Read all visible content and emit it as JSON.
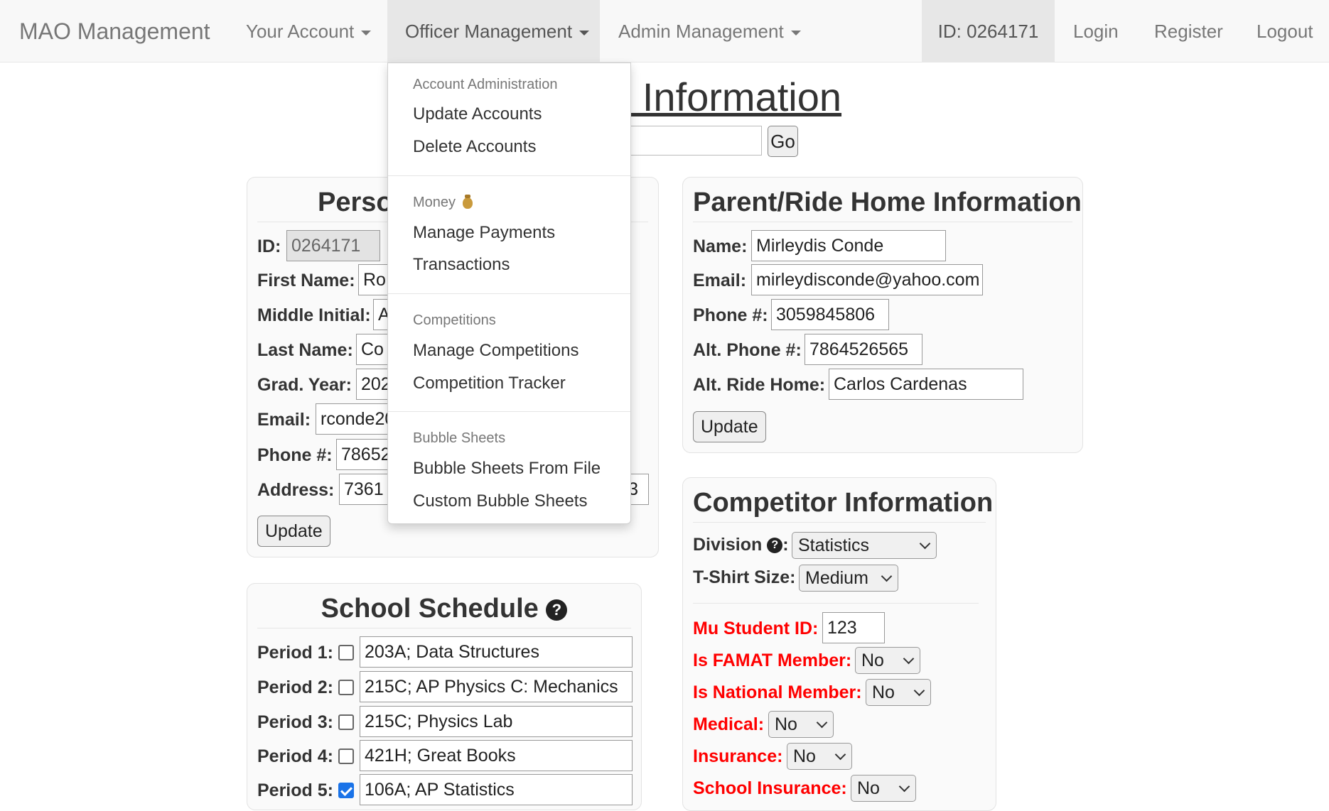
{
  "navbar": {
    "brand": "MAO Management",
    "menus": [
      "Your Account",
      "Officer Management",
      "Admin Management"
    ],
    "id_label": "ID: 0264171",
    "login": "Login",
    "register": "Register",
    "logout": "Logout"
  },
  "page": {
    "title": "Account Information",
    "go": "Go"
  },
  "dropdown": {
    "sections": [
      {
        "header": "Account Administration",
        "items": [
          "Update Accounts",
          "Delete Accounts"
        ]
      },
      {
        "header": "Money",
        "items": [
          "Manage Payments",
          "Transactions"
        ]
      },
      {
        "header": "Competitions",
        "items": [
          "Manage Competitions",
          "Competition Tracker"
        ]
      },
      {
        "header": "Bubble Sheets",
        "items": [
          "Bubble Sheets From File",
          "Custom Bubble Sheets"
        ]
      }
    ]
  },
  "personal": {
    "title": "Personal Information",
    "fields": [
      {
        "label": "ID:",
        "value": "0264171"
      },
      {
        "label": "First Name:",
        "value": "Ro"
      },
      {
        "label": "Middle Initial:",
        "value": "A"
      },
      {
        "label": "Last Name:",
        "value": "Co"
      },
      {
        "label": "Grad. Year:",
        "value": "202"
      },
      {
        "label": "Email:",
        "value": "rconde20"
      },
      {
        "label": "Phone #:",
        "value": "78652"
      },
      {
        "label": "Address:",
        "value": "7361",
        "value_tail": "3"
      }
    ],
    "update": "Update"
  },
  "parent": {
    "title": "Parent/Ride Home Information",
    "fields": [
      {
        "label": "Name:",
        "value": "Mirleydis Conde"
      },
      {
        "label": "Email:",
        "value": "mirleydisconde@yahoo.com"
      },
      {
        "label": "Phone #:",
        "value": "3059845806"
      },
      {
        "label": "Alt. Phone #:",
        "value": "7864526565"
      },
      {
        "label": "Alt. Ride Home:",
        "value": "Carlos Cardenas"
      }
    ],
    "update": "Update"
  },
  "schedule": {
    "title": "School Schedule",
    "periods": [
      {
        "label": "Period 1:",
        "value": "203A; Data Structures",
        "checked": false
      },
      {
        "label": "Period 2:",
        "value": "215C; AP Physics C: Mechanics",
        "checked": false
      },
      {
        "label": "Period 3:",
        "value": "215C; Physics Lab",
        "checked": false
      },
      {
        "label": "Period 4:",
        "value": "421H; Great Books",
        "checked": false
      },
      {
        "label": "Period 5:",
        "value": "106A; AP Statistics",
        "checked": true
      }
    ]
  },
  "competitor": {
    "title": "Competitor Information",
    "division_label": "Division",
    "division_colon": ":",
    "division_value": "Statistics",
    "tshirt_label": "T-Shirt Size:",
    "tshirt_value": "Medium",
    "mu_label": "Mu Student ID:",
    "mu_value": "123",
    "fields": [
      {
        "label": "Is FAMAT Member:",
        "value": "No"
      },
      {
        "label": "Is National Member:",
        "value": "No"
      },
      {
        "label": "Medical:",
        "value": "No"
      },
      {
        "label": "Insurance:",
        "value": "No"
      },
      {
        "label": "School Insurance:",
        "value": "No"
      }
    ]
  }
}
